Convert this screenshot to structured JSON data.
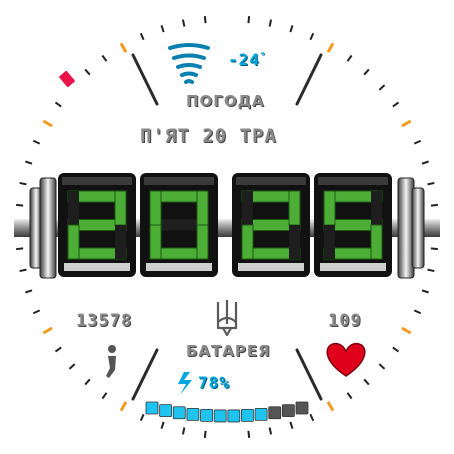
{
  "weather": {
    "temperature": "-24",
    "degree_symbol": "°",
    "label": "ПОГОДА",
    "icon": "weather-tornado-icon",
    "icon_color": "#0a7fb0"
  },
  "date": {
    "text": "П'ЯТ 20 ТРА"
  },
  "time": {
    "hours": "20",
    "minutes": "25",
    "digit_color": "#4cae37"
  },
  "steps": {
    "value": "13578",
    "icon": "walking-person-icon"
  },
  "emblem": {
    "icon": "ukraine-trident-icon"
  },
  "heart_rate": {
    "value": "109",
    "icon": "heart-icon",
    "color": "#e0001b"
  },
  "battery": {
    "label": "БАТАРЕЯ",
    "percent_text": "78%",
    "level": 0.78,
    "segments_total": 12,
    "segments_filled": 9,
    "icon": "lightning-icon",
    "fill_color": "#1ec4ef",
    "empty_color": "#555555"
  },
  "dial": {
    "accent_color": "#f39a1c",
    "marker_color": "#e8144a"
  }
}
